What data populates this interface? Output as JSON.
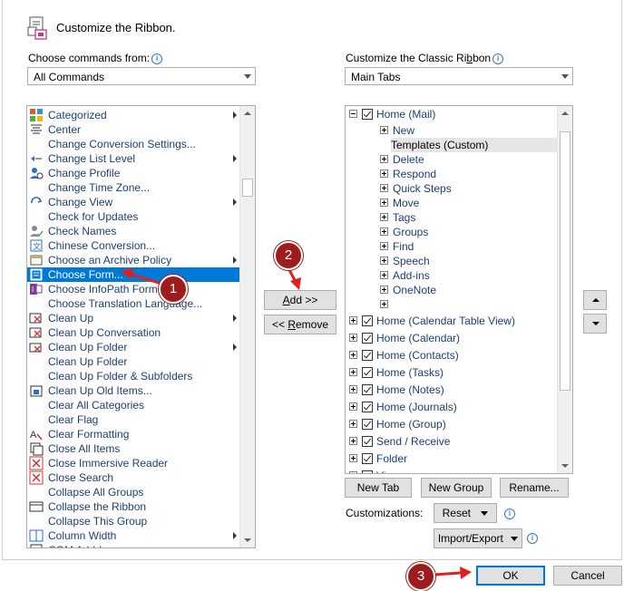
{
  "header": {
    "title": "Customize the Ribbon."
  },
  "left": {
    "label": "Choose commands from:",
    "combo_value": "All Commands",
    "items": [
      {
        "label": "Categorized",
        "icon": "categorized-icon",
        "submenu": true
      },
      {
        "label": "Center",
        "icon": "center-align-icon",
        "submenu": false
      },
      {
        "label": "Change Conversion Settings...",
        "icon": "",
        "submenu": false
      },
      {
        "label": "Change List Level",
        "icon": "list-level-icon",
        "submenu": true
      },
      {
        "label": "Change Profile",
        "icon": "profile-icon",
        "submenu": false
      },
      {
        "label": "Change Time Zone...",
        "icon": "",
        "submenu": false
      },
      {
        "label": "Change View",
        "icon": "change-view-icon",
        "submenu": true
      },
      {
        "label": "Check for Updates",
        "icon": "",
        "submenu": false
      },
      {
        "label": "Check Names",
        "icon": "check-names-icon",
        "submenu": false
      },
      {
        "label": "Chinese Conversion...",
        "icon": "chinese-conversion-icon",
        "submenu": false
      },
      {
        "label": "Choose an Archive Policy",
        "icon": "archive-policy-icon",
        "submenu": true
      },
      {
        "label": "Choose Form...",
        "icon": "form-icon",
        "submenu": false,
        "selected": true
      },
      {
        "label": "Choose InfoPath Form...",
        "icon": "infopath-icon",
        "submenu": false
      },
      {
        "label": "Choose Translation Language...",
        "icon": "",
        "submenu": false
      },
      {
        "label": "Clean Up",
        "icon": "clean-up-icon",
        "submenu": true
      },
      {
        "label": "Clean Up Conversation",
        "icon": "clean-up-conversation-icon",
        "submenu": false
      },
      {
        "label": "Clean Up Folder",
        "icon": "clean-up-folder-icon",
        "submenu": true
      },
      {
        "label": "Clean Up Folder",
        "icon": "",
        "submenu": false
      },
      {
        "label": "Clean Up Folder & Subfolders",
        "icon": "",
        "submenu": false
      },
      {
        "label": "Clean Up Old Items...",
        "icon": "clean-up-old-icon",
        "submenu": false
      },
      {
        "label": "Clear All Categories",
        "icon": "",
        "submenu": false
      },
      {
        "label": "Clear Flag",
        "icon": "",
        "submenu": false
      },
      {
        "label": "Clear Formatting",
        "icon": "clear-formatting-icon",
        "submenu": false
      },
      {
        "label": "Close All Items",
        "icon": "close-all-icon",
        "submenu": false
      },
      {
        "label": "Close Immersive Reader",
        "icon": "close-red-icon",
        "submenu": false
      },
      {
        "label": "Close Search",
        "icon": "close-red-icon",
        "submenu": false
      },
      {
        "label": "Collapse All Groups",
        "icon": "",
        "submenu": false
      },
      {
        "label": "Collapse the Ribbon",
        "icon": "collapse-ribbon-icon",
        "submenu": false
      },
      {
        "label": "Collapse This Group",
        "icon": "",
        "submenu": false
      },
      {
        "label": "Column Width",
        "icon": "column-width-icon",
        "submenu": true
      },
      {
        "label": "COM Add-Ins...",
        "icon": "com-addins-icon",
        "submenu": false
      }
    ]
  },
  "middle": {
    "add_label": "Add >>",
    "add_accel": "A",
    "add_rest": "dd >>",
    "remove_pre": "<< ",
    "remove_accel": "R",
    "remove_rest": "emove"
  },
  "right": {
    "label": "Customize the Classic Ribbon",
    "label_pre": "Customize the Classic Ri",
    "label_accel": "b",
    "label_rest": "bon",
    "combo_value": "Main Tabs",
    "tree": [
      {
        "label": "Home (Mail)",
        "level": 0,
        "expanded": true,
        "checkbox": true
      },
      {
        "label": "New",
        "level": 1,
        "expanded": false,
        "checkbox": false
      },
      {
        "label": "Templates (Custom)",
        "level": 1,
        "leaf": true,
        "checkbox": false,
        "selected": true
      },
      {
        "label": "Delete",
        "level": 1,
        "expanded": false,
        "checkbox": false
      },
      {
        "label": "Respond",
        "level": 1,
        "expanded": false,
        "checkbox": false
      },
      {
        "label": "Quick Steps",
        "level": 1,
        "expanded": false,
        "checkbox": false
      },
      {
        "label": "Move",
        "level": 1,
        "expanded": false,
        "checkbox": false
      },
      {
        "label": "Tags",
        "level": 1,
        "expanded": false,
        "checkbox": false
      },
      {
        "label": "Groups",
        "level": 1,
        "expanded": false,
        "checkbox": false
      },
      {
        "label": "Find",
        "level": 1,
        "expanded": false,
        "checkbox": false
      },
      {
        "label": "Speech",
        "level": 1,
        "expanded": false,
        "checkbox": false
      },
      {
        "label": "Add-ins",
        "level": 1,
        "expanded": false,
        "checkbox": false
      },
      {
        "label": "OneNote",
        "level": 1,
        "expanded": false,
        "checkbox": false
      },
      {
        "label": "",
        "level": 1,
        "expanded": false,
        "checkbox": false
      },
      {
        "label": "Home (Calendar Table View)",
        "level": 0,
        "expanded": false,
        "checkbox": true
      },
      {
        "label": "Home (Calendar)",
        "level": 0,
        "expanded": false,
        "checkbox": true
      },
      {
        "label": "Home (Contacts)",
        "level": 0,
        "expanded": false,
        "checkbox": true
      },
      {
        "label": "Home (Tasks)",
        "level": 0,
        "expanded": false,
        "checkbox": true
      },
      {
        "label": "Home (Notes)",
        "level": 0,
        "expanded": false,
        "checkbox": true
      },
      {
        "label": "Home (Journals)",
        "level": 0,
        "expanded": false,
        "checkbox": true
      },
      {
        "label": "Home (Group)",
        "level": 0,
        "expanded": false,
        "checkbox": true
      },
      {
        "label": "Send / Receive",
        "level": 0,
        "expanded": false,
        "checkbox": true
      },
      {
        "label": "Folder",
        "level": 0,
        "expanded": false,
        "checkbox": true
      },
      {
        "label": "View",
        "level": 0,
        "expanded": false,
        "checkbox": true
      }
    ],
    "new_tab": "New Tab",
    "new_group": "New Group",
    "rename": "Rename...",
    "customizations_label": "Customizations:",
    "reset_label": "Reset",
    "import_export_label": "Import/Export"
  },
  "footer": {
    "ok_label": "OK",
    "cancel_label": "Cancel"
  },
  "callouts": [
    "1",
    "2",
    "3"
  ],
  "colors": {
    "selection": "#0078d7",
    "callout": "#9e1c1c",
    "arrow": "#e02020",
    "link_text": "#1e3f73"
  }
}
